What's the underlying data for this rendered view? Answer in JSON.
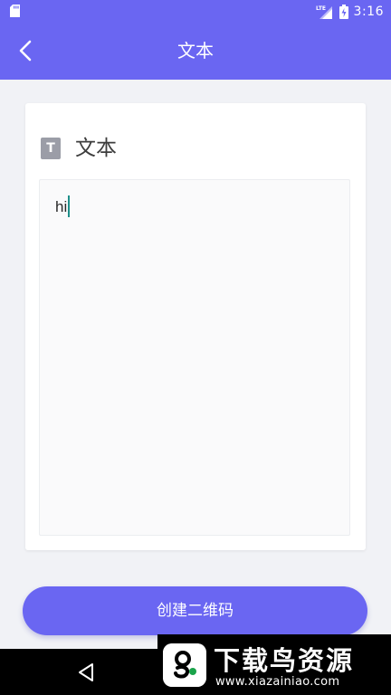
{
  "status_bar": {
    "time": "3:16",
    "network_label": "LTE"
  },
  "app_bar": {
    "title": "文本"
  },
  "card": {
    "icon_letter": "T",
    "title": "文本",
    "input_value": "hi"
  },
  "create_button": {
    "label": "创建二维码"
  },
  "watermark": {
    "title": "下载鸟资源",
    "url": "www.xiazainiao.com"
  },
  "colors": {
    "primary": "#6a66f2",
    "background": "#f1f2f6",
    "caret": "#1e8f8a"
  },
  "icons": [
    "sd-card-icon",
    "signal-icon",
    "battery-icon",
    "back-arrow-icon",
    "text-type-icon",
    "nav-back-icon"
  ]
}
